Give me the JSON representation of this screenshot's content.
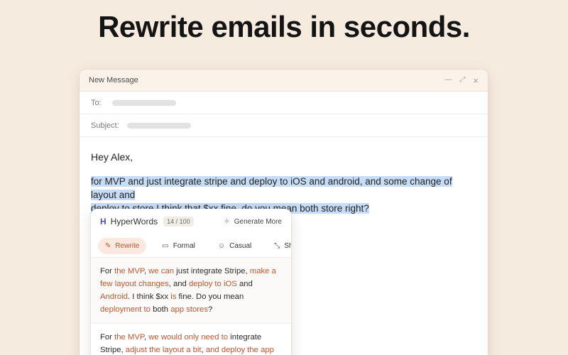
{
  "headline": "Rewrite emails in seconds.",
  "window": {
    "title": "New Message",
    "controls": {
      "minimize": "—",
      "expand": "⤢",
      "close": "×"
    }
  },
  "fields": {
    "to_label": "To:",
    "subject_label": "Subject:"
  },
  "email": {
    "greeting": "Hey Alex,",
    "selected_line1": "for MVP and just integrate stripe and deploy to iOS and android, and some change of layout and",
    "selected_line2": "deploy to store I think that $xx fine, do you mean both store right?"
  },
  "popup": {
    "logo": "H",
    "brand": "HyperWords",
    "counter": "14 / 100",
    "generate_more": "Generate More",
    "tabs": [
      {
        "label": "Rewrite",
        "icon": "pencil-icon",
        "active": true
      },
      {
        "label": "Formal",
        "icon": "briefcase-icon",
        "active": false
      },
      {
        "label": "Casual",
        "icon": "smile-icon",
        "active": false
      },
      {
        "label": "Short",
        "icon": "shrink-icon",
        "active": false
      }
    ],
    "suggestion1": {
      "s0": "For ",
      "h0": "the MVP",
      "s1": ", ",
      "h1": "we can",
      "s2": " just integrate Stripe, ",
      "h2": "make a few layout changes",
      "s3": ", and ",
      "h3": "deploy to iOS",
      "s4": " and ",
      "h4": "Android",
      "s5": ". I think $xx ",
      "h5": "is",
      "s6": " fine. Do you mean ",
      "h6": "deployment to",
      "s7": " both ",
      "h7": "app stores",
      "s8": "?"
    },
    "suggestion2": {
      "s0": "For ",
      "h0": "the MVP",
      "s1": ", ",
      "h1": "we would only need to",
      "s2": " integrate Stripe, ",
      "h2": "adjust the layout a bit",
      "s3": ", ",
      "h3": "and deploy the app"
    }
  },
  "colors": {
    "background": "#f6ebdf",
    "accent": "#c0562e",
    "selection": "#c6dcf7",
    "logo": "#4f4cc4"
  }
}
